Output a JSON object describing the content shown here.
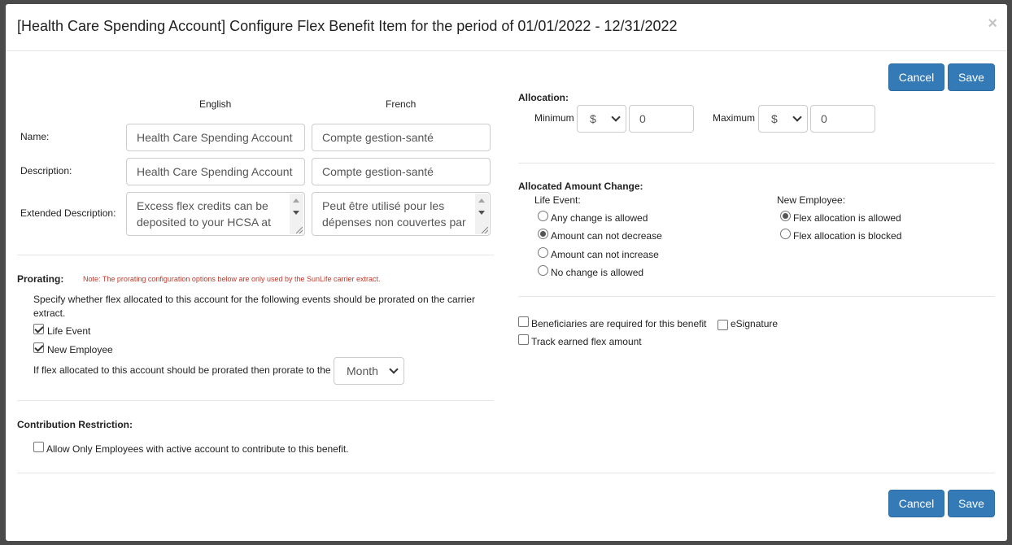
{
  "modal": {
    "title": "[Health Care Spending Account] Configure Flex Benefit Item for the period of 01/01/2022 - 12/31/2022",
    "close_label": "×",
    "cancel_label": "Cancel",
    "save_label": "Save"
  },
  "columns": {
    "english": "English",
    "french": "French"
  },
  "fields": {
    "name_label": "Name:",
    "name_en": "Health Care Spending Account",
    "name_fr": "Compte gestion-santé",
    "description_label": "Description:",
    "description_en": "Health Care Spending Account",
    "description_fr": "Compte gestion-santé",
    "ext_description_label": "Extended Description:",
    "ext_description_en": "Excess flex credits can be deposited to your HCSA at",
    "ext_description_fr": "Peut être utilisé pour les dépenses non couvertes par"
  },
  "prorating": {
    "heading": "Prorating:",
    "note": "Note: The prorating configuration options below are only used by the SunLife carrier extract.",
    "description_line1": "Specify whether flex allocated to this account for the following events should be prorated on the carrier",
    "description_line2": "extract.",
    "life_event_label": "Life Event",
    "new_employee_label": "New Employee",
    "prorate_to_label": "If flex allocated to this account should be prorated then prorate to the",
    "prorate_to_value": "Month"
  },
  "contribution": {
    "heading": "Contribution Restriction:",
    "allow_label": "Allow Only Employees with active account to contribute to this benefit."
  },
  "allocation": {
    "heading": "Allocation:",
    "minimum_label": "Minimum",
    "minimum_currency": "$",
    "minimum_value": "0",
    "maximum_label": "Maximum",
    "maximum_currency": "$",
    "maximum_value": "0"
  },
  "allocated_change": {
    "heading": "Allocated Amount Change:",
    "life_event_heading": "Life Event:",
    "life_event_options": [
      "Any change is allowed",
      "Amount can not decrease",
      "Amount can not increase",
      "No change is allowed"
    ],
    "life_event_selected": 1,
    "new_employee_heading": "New Employee:",
    "new_employee_options": [
      "Flex allocation is allowed",
      "Flex allocation is blocked"
    ],
    "new_employee_selected": 0
  },
  "options": {
    "beneficiaries_label": "Beneficiaries are required for this benefit",
    "esignature_label": "eSignature",
    "track_flex_label": "Track earned flex amount"
  },
  "colors": {
    "primary": "#337ab7",
    "note": "#c0392b",
    "overlay": "#4a4a4a"
  }
}
